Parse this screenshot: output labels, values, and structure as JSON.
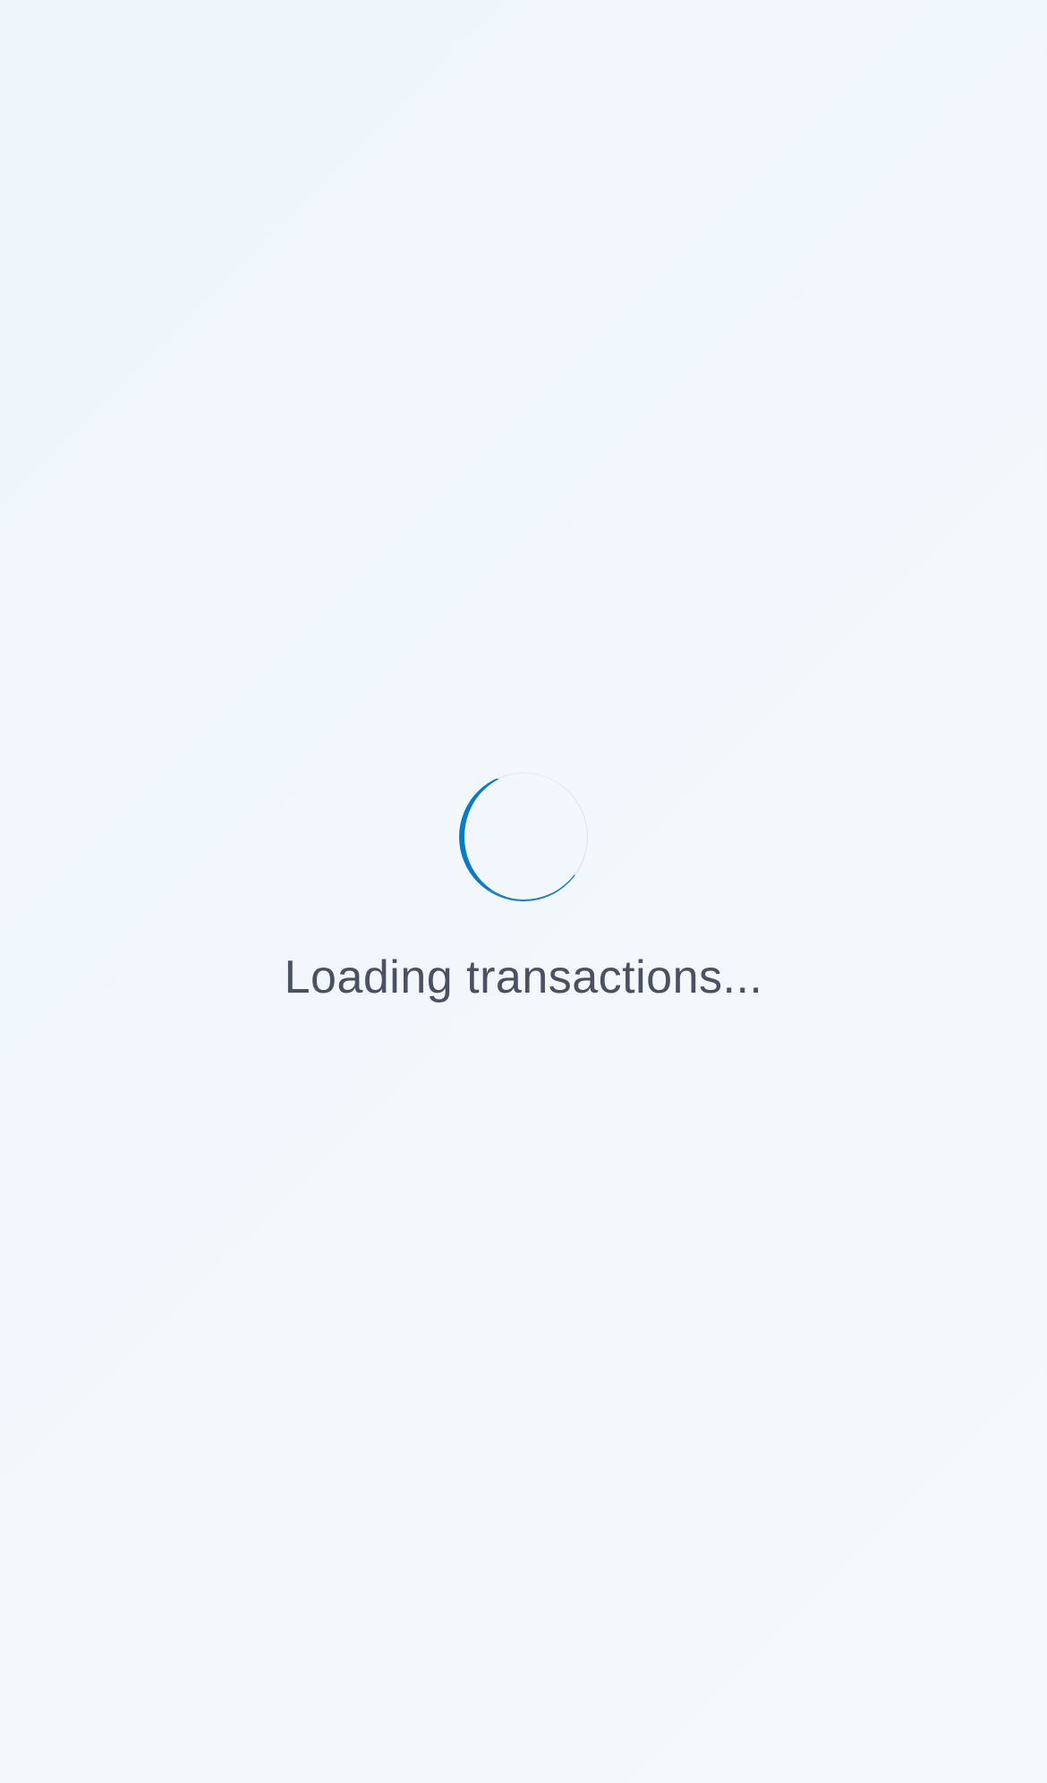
{
  "loading": {
    "message": "Loading transactions...",
    "spinner_icon": "loading-spinner-icon",
    "spinner_color": "#0a7cc2",
    "text_color": "#4a5261",
    "background_color": "#f1f7fc"
  }
}
